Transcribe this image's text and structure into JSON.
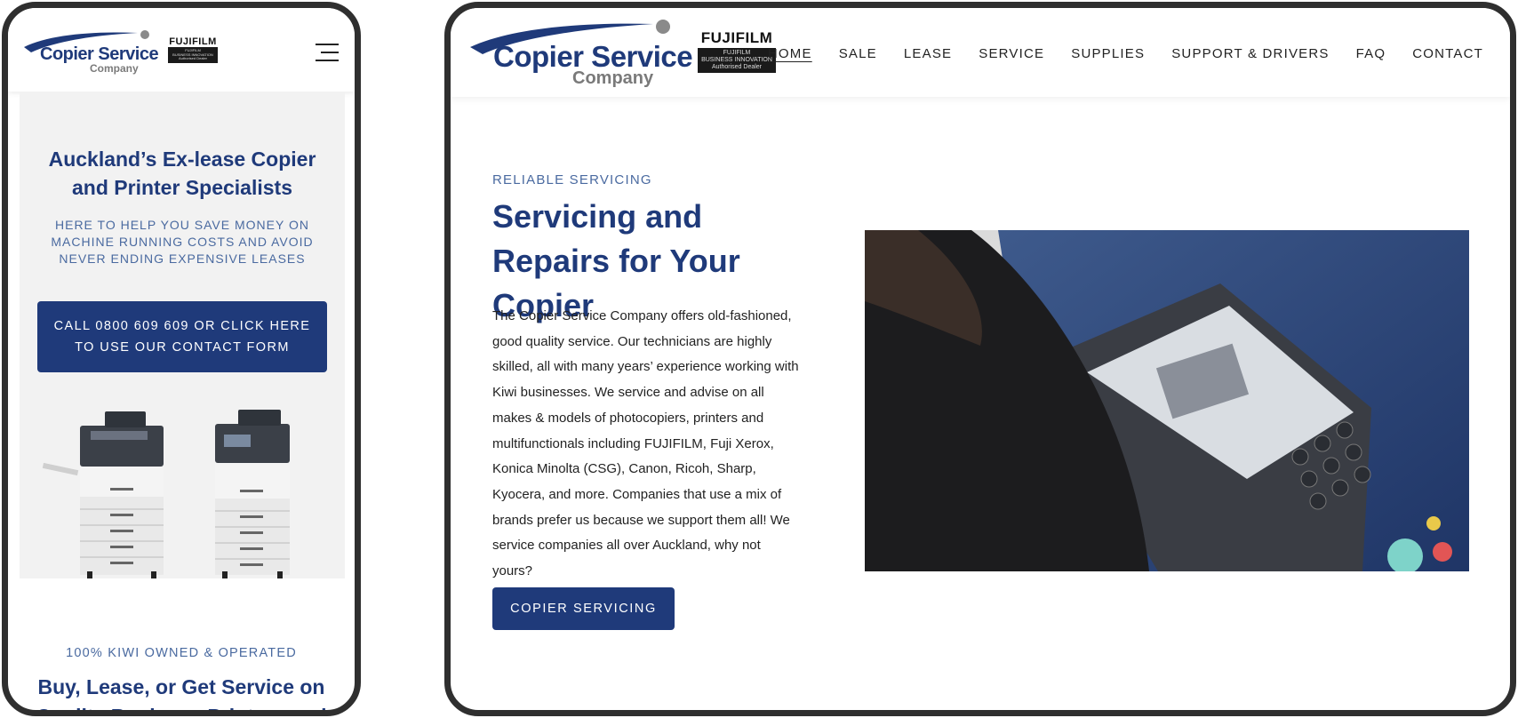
{
  "brand": {
    "logo_main": "Copier Service",
    "logo_sub": "Company",
    "partner_name": "FUJIFILM",
    "partner_line1": "FUJIFILM",
    "partner_line2": "BUSINESS INNOVATION",
    "partner_line3": "Authorised Dealer"
  },
  "mobile": {
    "menu_icon": "hamburger-menu-icon",
    "hero_title": "Auckland’s Ex-lease Copier and Printer Specialists",
    "hero_subtitle": "HERE TO HELP YOU SAVE MONEY ON MACHINE RUNNING COSTS AND AVOID NEVER ENDING EXPENSIVE LEASES",
    "cta_label": "CALL 0800 609 609 OR CLICK HERE TO USE OUR CONTACT FORM",
    "tagline": "100% KIWI OWNED & OPERATED",
    "section_title": "Buy, Lease, or Get Service on Quality Business Printers and"
  },
  "desktop": {
    "nav": [
      "HOME",
      "SALE",
      "LEASE",
      "SERVICE",
      "SUPPLIES",
      "SUPPORT & DRIVERS",
      "FAQ",
      "CONTACT"
    ],
    "active_nav": "HOME",
    "eyebrow": "RELIABLE SERVICING",
    "title": "Servicing and Repairs for Your Copier",
    "body": "The Copier Service Company offers old-fashioned, good quality service. Our technicians are highly skilled, all with many years’ experience working with Kiwi businesses. We service and advise on all makes & models of photocopiers, printers and multifunctionals including FUJIFILM, Fuji Xerox, Konica Minolta (CSG), Canon, Ricoh, Sharp, Kyocera, and more. Companies that use a mix of brands prefer us because we support them all! We service companies all over Auckland, why not yours?",
    "cta_label": "COPIER SERVICING"
  },
  "colors": {
    "brand_blue": "#1f3a7a",
    "accent_blue": "#4a6aa0",
    "frame": "#2f2f2f",
    "hero_bg": "#f2f2f2"
  }
}
